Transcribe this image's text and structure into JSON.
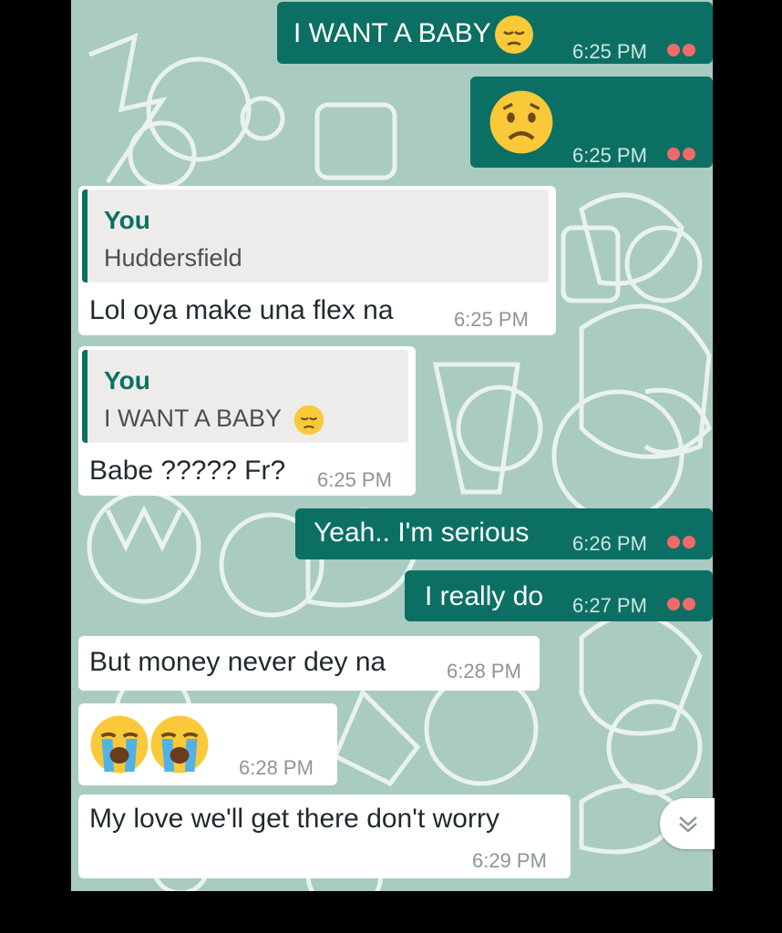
{
  "messages": [
    {
      "id": "m1",
      "direction": "outgoing",
      "text": "I WANT A BABY",
      "emoji": "pensive-face",
      "time": "6:25 PM",
      "status": "read"
    },
    {
      "id": "m2",
      "direction": "outgoing",
      "text": "",
      "emoji": "worried-face",
      "time": "6:25 PM",
      "status": "read"
    },
    {
      "id": "m3",
      "direction": "incoming",
      "quote": {
        "author": "You",
        "text": "Huddersfield"
      },
      "text": "Lol oya make una flex na",
      "time": "6:25 PM"
    },
    {
      "id": "m4",
      "direction": "incoming",
      "quote": {
        "author": "You",
        "text": "I WANT A BABY",
        "emoji": "pensive-face"
      },
      "text": "Babe ????? Fr?",
      "time": "6:25 PM"
    },
    {
      "id": "m5",
      "direction": "outgoing",
      "text": "Yeah.. I'm serious",
      "time": "6:26 PM",
      "status": "read"
    },
    {
      "id": "m6",
      "direction": "outgoing",
      "text": "I really do",
      "time": "6:27 PM",
      "status": "read"
    },
    {
      "id": "m7",
      "direction": "incoming",
      "text": "But money never dey na",
      "time": "6:28 PM"
    },
    {
      "id": "m8",
      "direction": "incoming",
      "text": "",
      "emoji": "loudly-crying-face x2",
      "time": "6:28 PM"
    },
    {
      "id": "m9",
      "direction": "incoming",
      "text": "My love we'll get there don't worry",
      "time": "6:29 PM"
    }
  ],
  "colors": {
    "outgoing_bubble": "#0b7063",
    "incoming_bubble": "#ffffff",
    "quote_bar": "#0b7063",
    "read_ticks": "#f16a6a",
    "wallpaper": "#a9cbc2"
  },
  "icons": {
    "scroll_down": "double-chevron-down-icon"
  }
}
